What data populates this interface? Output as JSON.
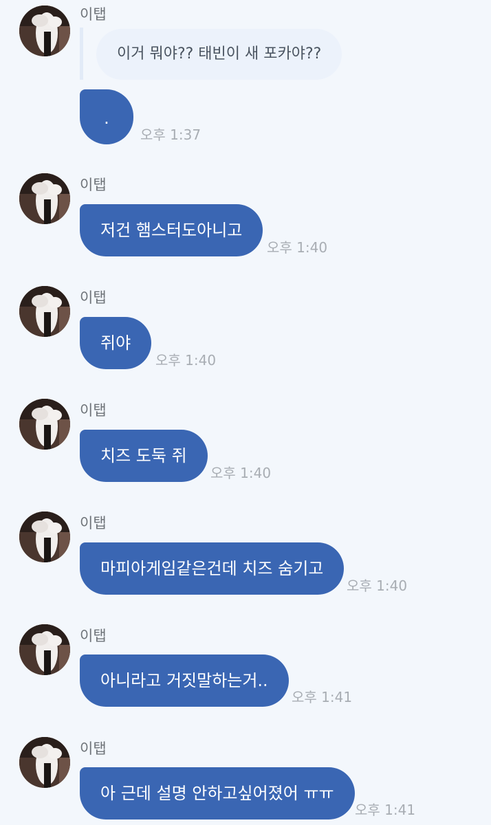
{
  "colors": {
    "background": "#f3f7fc",
    "bubble": "#3a66b3",
    "reply_bubble": "#ecf2fb",
    "time_text": "#a8adb3",
    "sender_text": "#6e7378"
  },
  "reply": {
    "text": "이거 뭐야?? 태빈이 새 포카야??"
  },
  "messages": [
    {
      "sender": "이탭",
      "text": ".",
      "time": "오후 1:37"
    },
    {
      "sender": "이탭",
      "text": "저건 햄스터도아니고",
      "time": "오후 1:40"
    },
    {
      "sender": "이탭",
      "text": "쥐야",
      "time": "오후 1:40"
    },
    {
      "sender": "이탭",
      "text": "치즈 도둑 쥐",
      "time": "오후 1:40"
    },
    {
      "sender": "이탭",
      "text": "마피아게임같은건데 치즈 숨기고",
      "time": "오후 1:40"
    },
    {
      "sender": "이탭",
      "text": "아니라고 거짓말하는거..",
      "time": "오후 1:41"
    },
    {
      "sender": "이탭",
      "text": "아 근데 설명 안하고싶어졌어 ㅠㅠ",
      "time": "오후 1:41"
    }
  ]
}
